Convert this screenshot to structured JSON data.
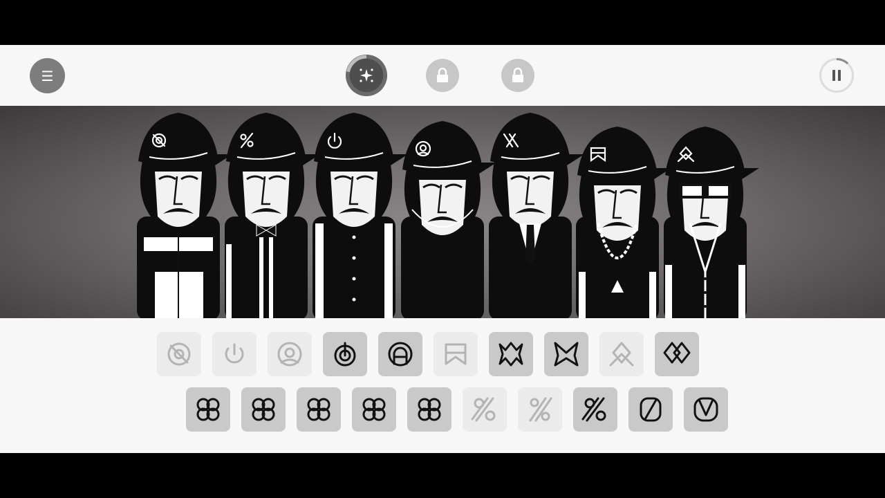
{
  "topbar": {
    "menu_icon": "hamburger-icon",
    "bonus_icon": "sparkle-icon",
    "bonus_progress": 0.78,
    "locks": [
      {
        "icon": "lock-icon"
      },
      {
        "icon": "lock-icon"
      }
    ],
    "pause_icon": "pause-icon",
    "loop_progress": 0.12
  },
  "stage": {
    "characters": [
      {
        "hat_symbol": "target",
        "shirt": "white-zip-jacket"
      },
      {
        "hat_symbol": "percent",
        "shirt": "bowtie-striped"
      },
      {
        "hat_symbol": "power",
        "shirt": "vest-buttons"
      },
      {
        "hat_symbol": "at-ring",
        "shirt": "hooded"
      },
      {
        "hat_symbol": "double-x",
        "shirt": "suit-tie"
      },
      {
        "hat_symbol": "banner",
        "shirt": "chain-necklace"
      },
      {
        "hat_symbol": "diamond-loop",
        "shirt": "cardigan-glasses"
      }
    ]
  },
  "sound_rows": [
    [
      {
        "icon": "target-icon",
        "state": "dim"
      },
      {
        "icon": "power-icon",
        "state": "dim"
      },
      {
        "icon": "at-ring-icon",
        "state": "dim"
      },
      {
        "icon": "power-ring-icon",
        "state": "active"
      },
      {
        "icon": "arch-ring-icon",
        "state": "active"
      },
      {
        "icon": "banner-icon",
        "state": "dim"
      },
      {
        "icon": "star-burst-icon",
        "state": "active"
      },
      {
        "icon": "m-zigzag-icon",
        "state": "active"
      },
      {
        "icon": "diamond-loop-icon",
        "state": "dim"
      },
      {
        "icon": "double-diamond-icon",
        "state": "active"
      }
    ],
    [
      {
        "icon": "clover-icon",
        "state": "active"
      },
      {
        "icon": "clover-icon",
        "state": "active"
      },
      {
        "icon": "clover-icon",
        "state": "active"
      },
      {
        "icon": "clover-icon",
        "state": "active"
      },
      {
        "icon": "clover-icon",
        "state": "active"
      },
      {
        "icon": "percent-icon",
        "state": "dim"
      },
      {
        "icon": "double-slash-icon",
        "state": "dim"
      },
      {
        "icon": "percent-icon",
        "state": "active"
      },
      {
        "icon": "zero-slash-icon",
        "state": "active"
      },
      {
        "icon": "v-zero-icon",
        "state": "active"
      }
    ]
  ]
}
